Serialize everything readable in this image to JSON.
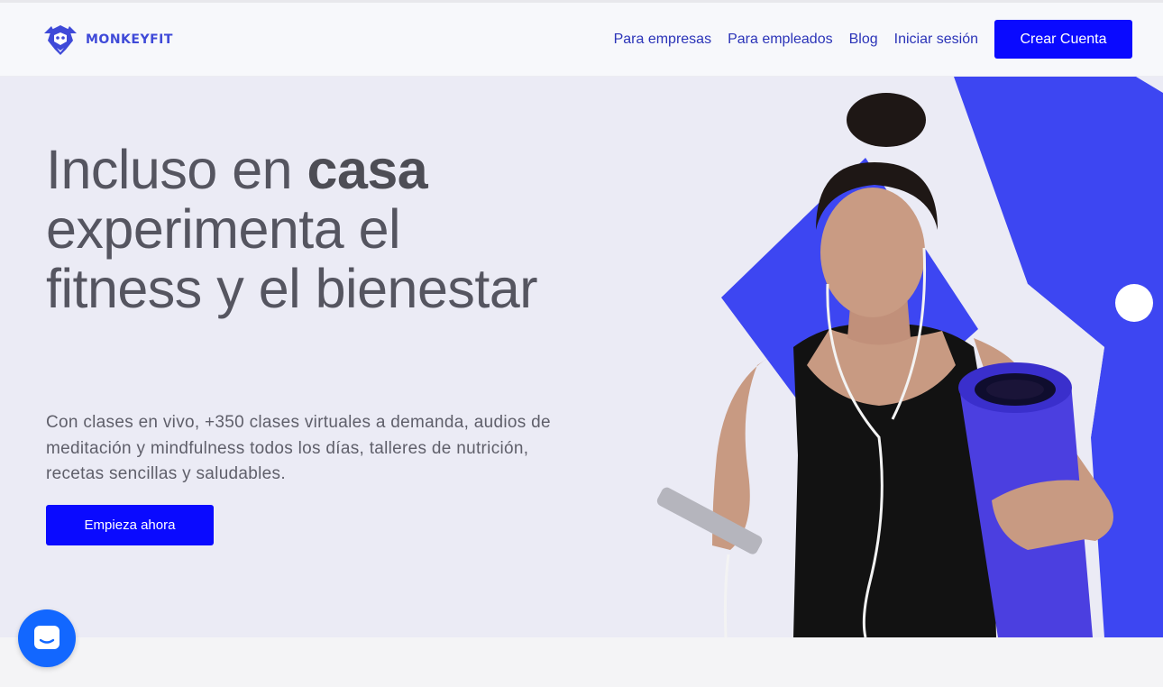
{
  "brand": {
    "name": "MONKEYFIT",
    "color": "#3f4ad8"
  },
  "nav": {
    "links": [
      "Para empresas",
      "Para empleados",
      "Blog",
      "Iniciar sesión"
    ],
    "cta": "Crear Cuenta"
  },
  "hero": {
    "title_prefix": "Incluso en ",
    "title_bold": "casa",
    "title_rest": "experimenta el fitness y el bienestar",
    "description": "Con clases en vivo, +350 clases virtuales a demanda, audios de meditación y mindfulness todos los días, talleres de nutrición, recetas sencillas y saludables.",
    "button": "Empieza ahora"
  },
  "colors": {
    "accent": "#0a0aff",
    "shape_blue": "#3d46f2",
    "hero_bg": "#ebebf5",
    "chat": "#1267ff"
  },
  "icons": {
    "logo": "monkey-logo-icon",
    "chat": "chat-bubble-icon"
  }
}
